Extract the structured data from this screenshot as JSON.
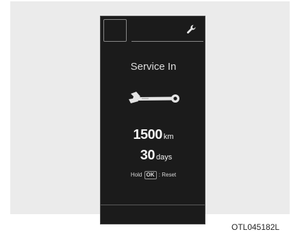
{
  "display": {
    "title": "Service In",
    "distance_value": "1500",
    "distance_unit": "km",
    "days_value": "30",
    "days_unit": "days",
    "hint_prefix": "Hold",
    "hint_key": "OK",
    "hint_suffix": ": Reset",
    "icons": {
      "top_right": "wrench-icon",
      "center": "wrench-icon"
    }
  },
  "figure_code": "OTL045182L"
}
